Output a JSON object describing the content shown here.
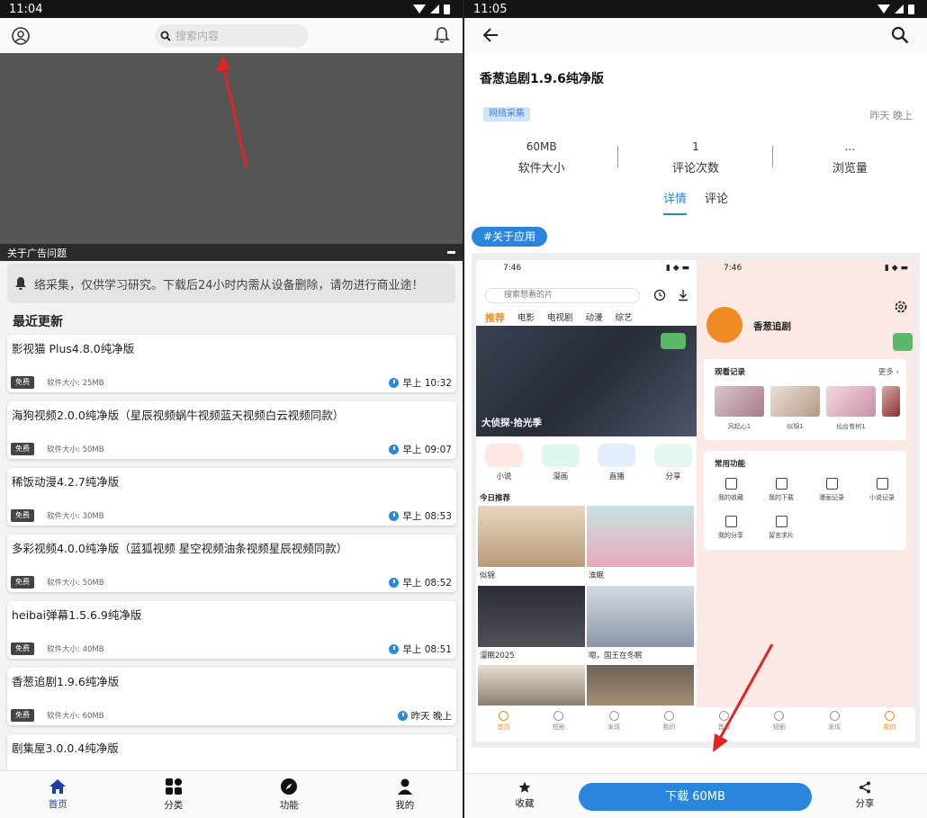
{
  "left": {
    "status_time": "11:04",
    "search_placeholder": "搜索内容",
    "ad_bar_label": "关于广告问题",
    "notice_text": "络采集，仅供学习研究。下载后24小时内需从设备删除，请勿进行商业途！",
    "section_title": "最近更新",
    "items": [
      {
        "title": "影视猫 Plus4.8.0纯净版",
        "badge": "免费",
        "size": "软件大小: 25MB",
        "time": "早上 10:32"
      },
      {
        "title": "海狗视频2.0.0纯净版（星辰视频蜗牛视频蓝天视频白云视频同款）",
        "badge": "免费",
        "size": "软件大小: 50MB",
        "time": "早上 09:07"
      },
      {
        "title": "稀饭动漫4.2.7纯净版",
        "badge": "免费",
        "size": "软件大小: 30MB",
        "time": "早上 08:53"
      },
      {
        "title": "多彩视频4.0.0纯净版（蓝狐视频 星空视频油条视频星辰视频同款）",
        "badge": "免费",
        "size": "软件大小: 50MB",
        "time": "早上 08:52"
      },
      {
        "title": "heibai弹幕1.5.6.9纯净版",
        "badge": "免费",
        "size": "软件大小: 40MB",
        "time": "早上 08:51"
      },
      {
        "title": "香葱追剧1.9.6纯净版",
        "badge": "免费",
        "size": "软件大小: 60MB",
        "time": "昨天 晚上"
      },
      {
        "title": "剧集屋3.0.0.4纯净版",
        "badge": "",
        "size": "",
        "time": ""
      }
    ],
    "nav": [
      {
        "label": "首页",
        "icon": "home-icon"
      },
      {
        "label": "分类",
        "icon": "grid-icon"
      },
      {
        "label": "功能",
        "icon": "compass-icon"
      },
      {
        "label": "我的",
        "icon": "user-icon"
      }
    ]
  },
  "right": {
    "status_time": "11:05",
    "app_title": "香葱追剧1.9.6纯净版",
    "tag": "网络采集",
    "date": "昨天 晚上",
    "stats": [
      {
        "value": "60MB",
        "label": "软件大小"
      },
      {
        "value": "1",
        "label": "评论次数"
      },
      {
        "value": "...",
        "label": "浏览量"
      }
    ],
    "tabs": [
      "详情",
      "评论"
    ],
    "about_label": "#关于应用",
    "fav_label": "收藏",
    "download_label": "下载 60MB",
    "share_label": "分享",
    "shot_a": {
      "time": "7:46",
      "search_placeholder": "搜索想看的片",
      "categories": [
        "推荐",
        "电影",
        "电视剧",
        "动漫",
        "综艺"
      ],
      "hero_caption": "大侦探·拾光季",
      "quick": [
        "小说",
        "漫画",
        "直播",
        "分享"
      ],
      "today_label": "今日推荐",
      "posters": [
        "似锦",
        "淮眠",
        "漫眠2025",
        "嗯，国王在冬眠"
      ],
      "nav": [
        "首页",
        "短剧",
        "发现",
        "我的"
      ]
    },
    "shot_b": {
      "time": "7:46",
      "app_name": "香葱追剧",
      "history_title": "观看记录",
      "history_more": "更多 ›",
      "history_items": [
        "风起心1",
        "似锦1",
        "仙台有树1"
      ],
      "func_title": "常用功能",
      "funcs": [
        "我的收藏",
        "我的下载",
        "漫画记录",
        "小说记录",
        "我的分享",
        "留言求片"
      ],
      "nav": [
        "首页",
        "短剧",
        "发现",
        "我的"
      ]
    }
  }
}
